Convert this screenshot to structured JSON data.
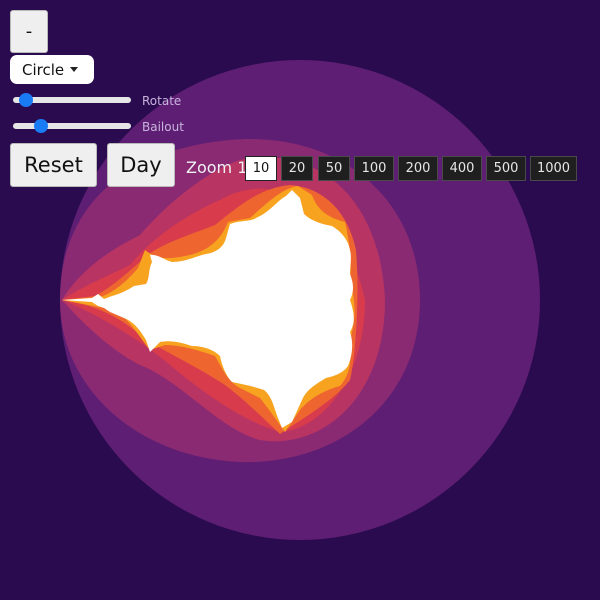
{
  "controls": {
    "collapse_label": "-",
    "shape_select": {
      "selected": "Circle"
    },
    "rotate": {
      "label": "Rotate",
      "value_fraction": 0.06
    },
    "bailout": {
      "label": "Bailout",
      "value_fraction": 0.2
    },
    "reset_label": "Reset",
    "day_label": "Day"
  },
  "zoom": {
    "label": "Zoom 1",
    "options": [
      "10",
      "20",
      "50",
      "100",
      "200",
      "400",
      "500",
      "1000"
    ],
    "selected": "10"
  },
  "colors": {
    "background": "#2a0b4f",
    "outer_band": "#5e1e73",
    "band_2": "#8a2a73",
    "band_3": "#b83463",
    "band_4": "#d83c4c",
    "band_5": "#ee6530",
    "band_6": "#f7a320",
    "set_interior": "#ffffff",
    "slider_thumb": "#1a7cf5"
  }
}
